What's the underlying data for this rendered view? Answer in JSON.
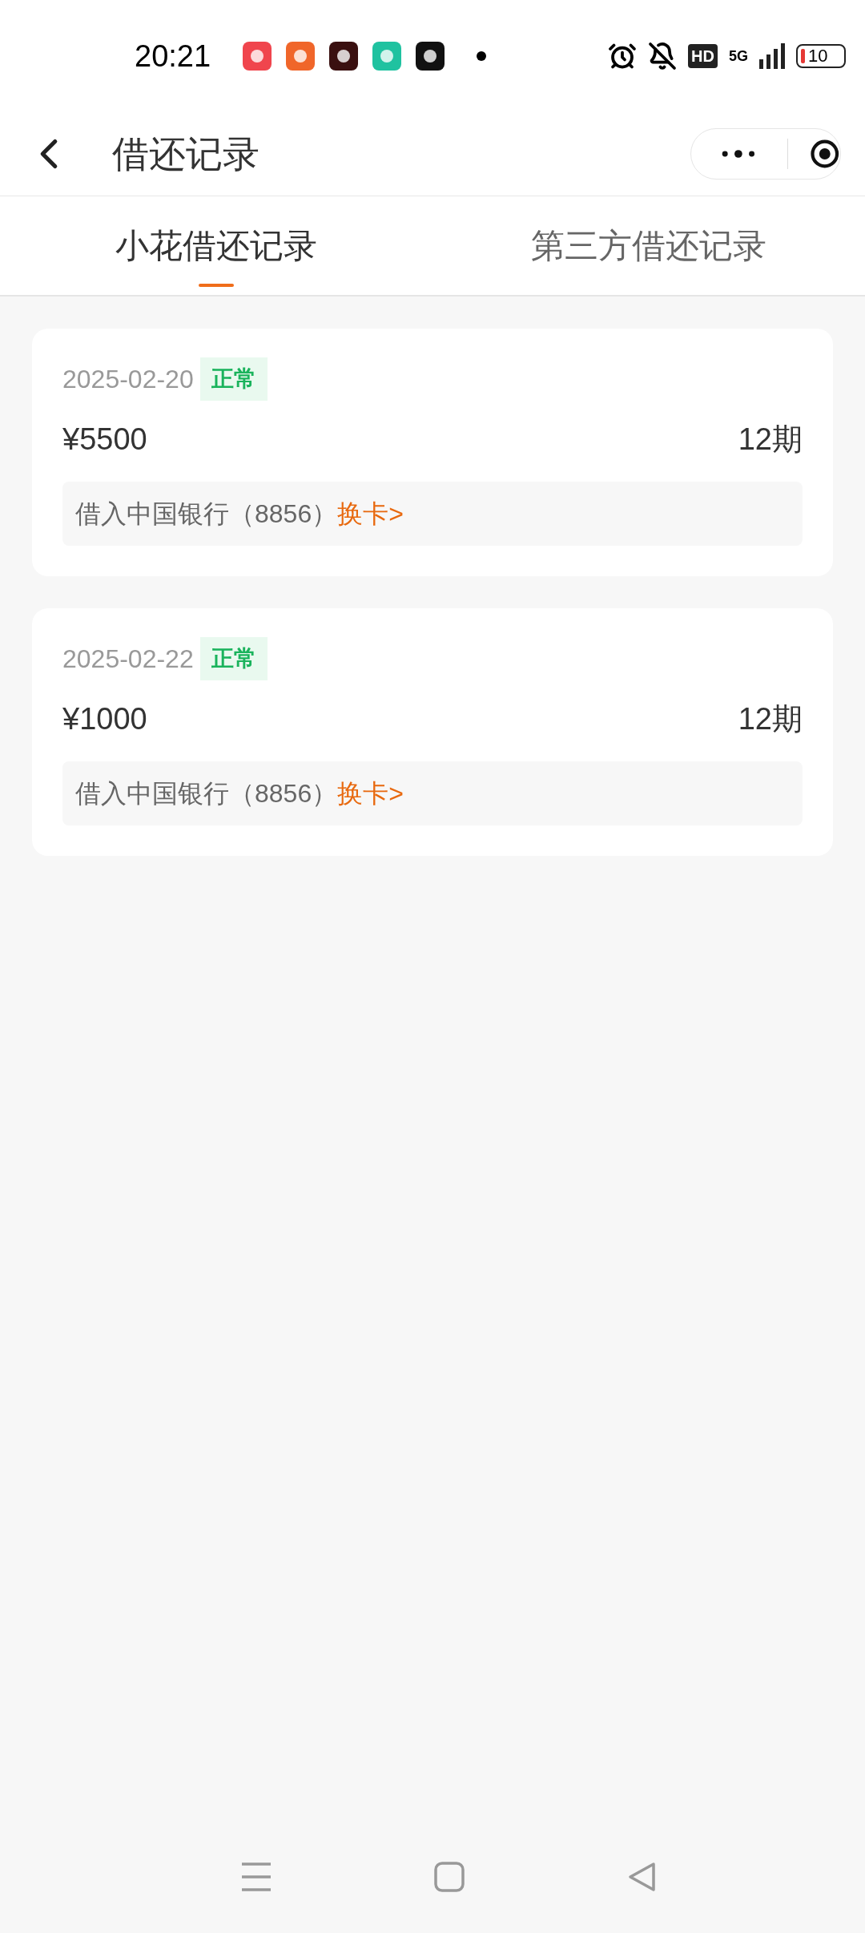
{
  "status_bar": {
    "time": "20:21",
    "network": "5G",
    "hd": "HD",
    "battery": "10"
  },
  "header": {
    "title": "借还记录"
  },
  "tabs": [
    {
      "label": "小花借还记录",
      "selected": true
    },
    {
      "label": "第三方借还记录",
      "selected": false
    }
  ],
  "records": [
    {
      "date": "2025-02-20",
      "status": "正常",
      "amount": "¥5500",
      "term": "12期",
      "account": "借入中国银行（8856）",
      "link": "换卡>"
    },
    {
      "date": "2025-02-22",
      "status": "正常",
      "amount": "¥1000",
      "term": "12期",
      "account": "借入中国银行（8856）",
      "link": "换卡>"
    }
  ]
}
